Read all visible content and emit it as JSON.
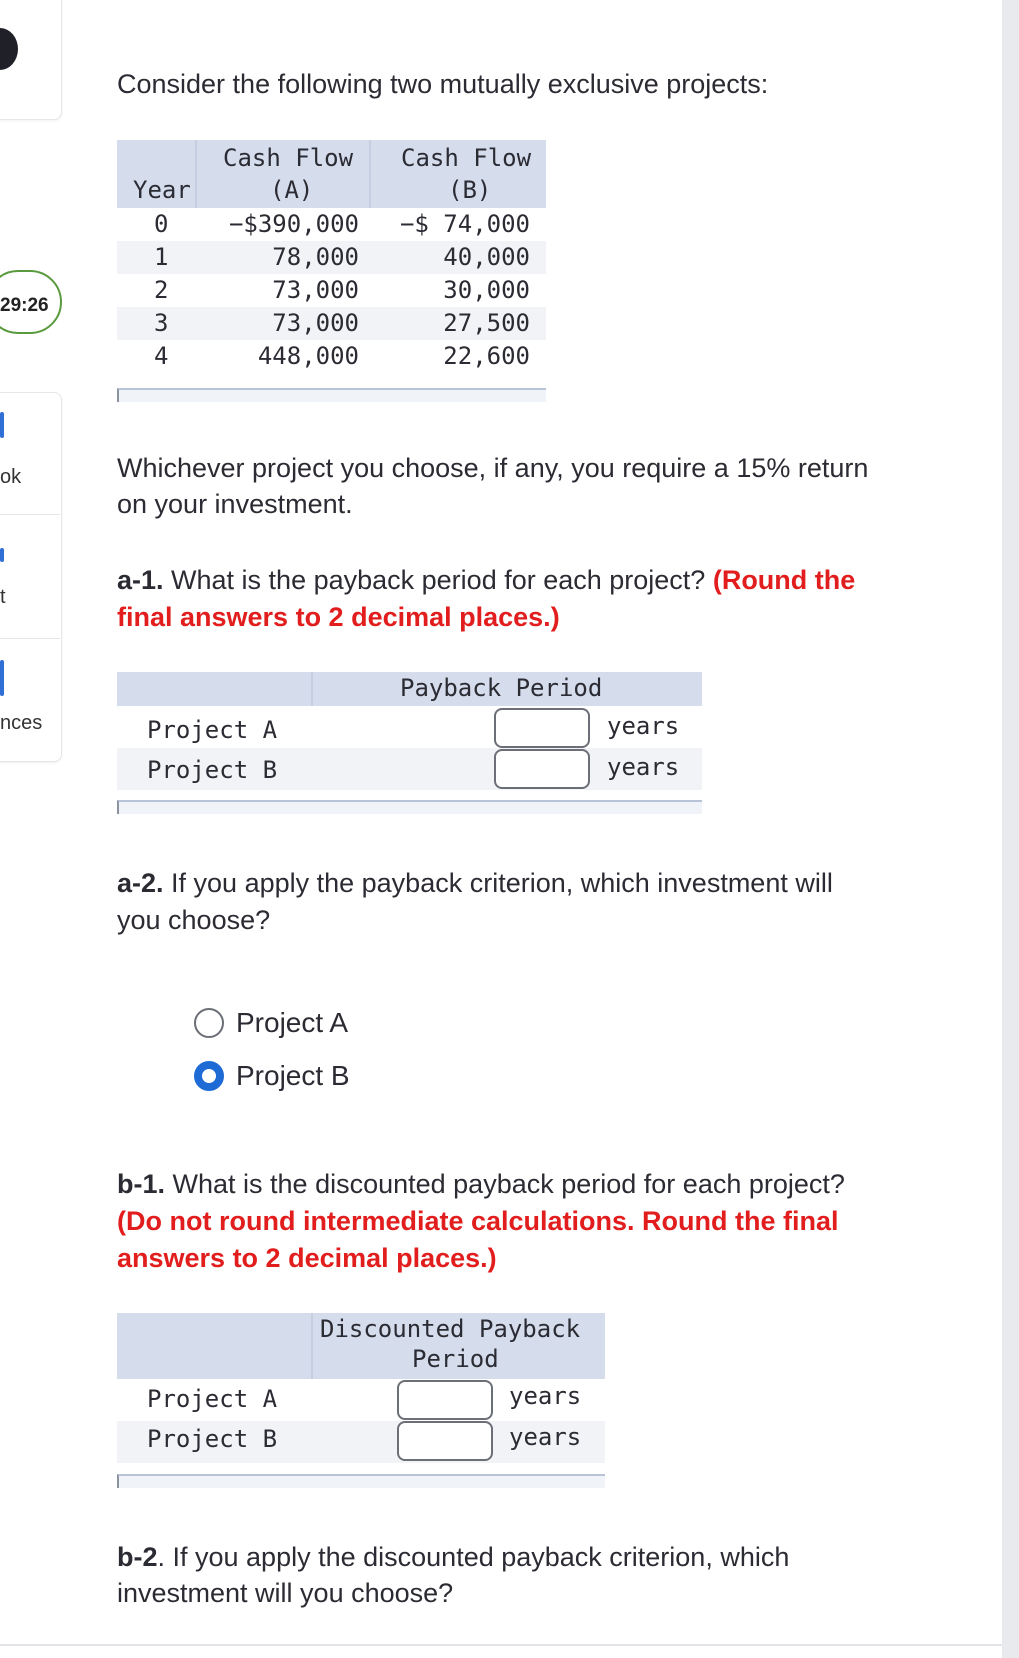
{
  "sidebar": {
    "timer": "29:26",
    "items": [
      {
        "label": "ok"
      },
      {
        "label": "t"
      },
      {
        "label": "nces"
      }
    ]
  },
  "intro": "Consider the following two mutually exclusive projects:",
  "cashflow_table": {
    "headers": {
      "year": "Year",
      "a_line1": "Cash Flow",
      "a_line2": "(A)",
      "b_line1": "Cash Flow",
      "b_line2": "(B)"
    },
    "rows": [
      {
        "year": "0",
        "a": "−$390,000",
        "b": "−$ 74,000"
      },
      {
        "year": "1",
        "a": "78,000",
        "b": "40,000"
      },
      {
        "year": "2",
        "a": "73,000",
        "b": "30,000"
      },
      {
        "year": "3",
        "a": "73,000",
        "b": "27,500"
      },
      {
        "year": "4",
        "a": "448,000",
        "b": "22,600"
      }
    ]
  },
  "return_text_line1": "Whichever project you choose, if any, you require a 15% return",
  "return_text_line2": "on your investment.",
  "a1": {
    "label": "a-1.",
    "question": " What is the payback period for each project? ",
    "instruction_part1": "(Round the",
    "instruction_part2": "final answers to 2 decimal places.)",
    "table_header": "Payback Period",
    "rows": [
      {
        "project": "Project A",
        "value": "",
        "unit": "years"
      },
      {
        "project": "Project B",
        "value": "",
        "unit": "years"
      }
    ]
  },
  "a2": {
    "label": "a-2.",
    "question_line1": " If you apply the payback criterion, which investment will",
    "question_line2": "you choose?",
    "options": [
      {
        "label": "Project A",
        "selected": false
      },
      {
        "label": "Project B",
        "selected": true
      }
    ]
  },
  "b1": {
    "label": "b-1.",
    "question": " What is the discounted payback period for each project?",
    "instruction_line1": "(Do not round intermediate calculations. Round the final",
    "instruction_line2": "answers to 2 decimal places.)",
    "table_header_line1": "Discounted Payback",
    "table_header_line2": "Period",
    "rows": [
      {
        "project": "Project A",
        "value": "",
        "unit": "years"
      },
      {
        "project": "Project B",
        "value": "",
        "unit": "years"
      }
    ]
  },
  "b2": {
    "label": "b-2",
    "question_line1": ". If you apply the discounted payback criterion, which",
    "question_line2": "investment will you choose?"
  },
  "colors": {
    "accent": "#1f6bd6",
    "instruction_red": "#e21d1d",
    "table_header_bg": "#d5dcec",
    "timer_border": "#5a9a3e"
  }
}
